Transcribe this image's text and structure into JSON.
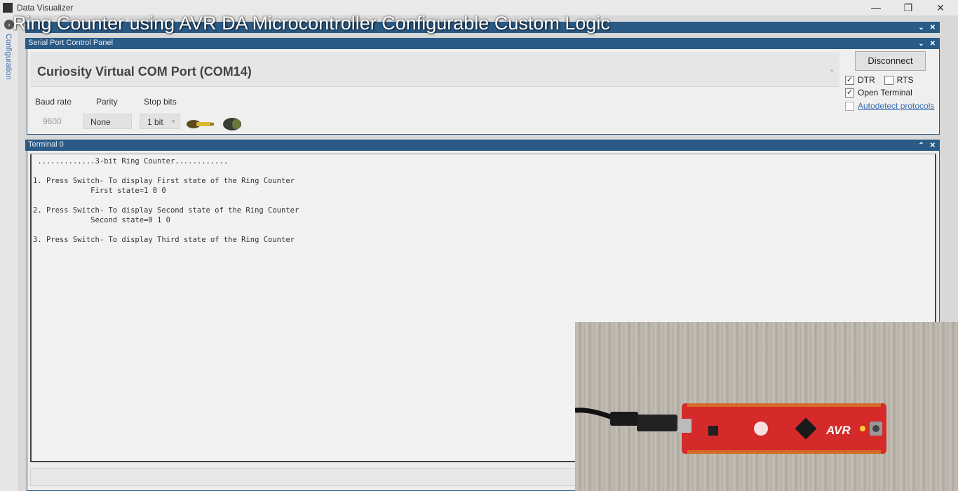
{
  "window": {
    "title": "Data Visualizer",
    "minimize": "—",
    "maximize": "❐",
    "close": "✕"
  },
  "video_title": "Ring Counter using AVR DA Microcontroller Configurable Custom Logic",
  "sidebar": {
    "label": "Configuration"
  },
  "serial_panel": {
    "title": "Serial Port Control Panel",
    "port_name": "Curiosity Virtual COM Port (COM14)",
    "labels": {
      "baud": "Baud rate",
      "parity": "Parity",
      "stop": "Stop bits"
    },
    "values": {
      "baud": "9600",
      "parity": "None",
      "stop": "1 bit"
    },
    "disconnect_label": "Disconnect",
    "checkboxes": {
      "dtr": {
        "label": "DTR",
        "checked": true
      },
      "rts": {
        "label": "RTS",
        "checked": false
      },
      "open_terminal": {
        "label": "Open Terminal",
        "checked": true
      },
      "autodetect": {
        "label": "Autodetect protocols",
        "checked": false
      }
    }
  },
  "terminal": {
    "title": "Terminal 0",
    "lines": [
      " .............3-bit Ring Counter............",
      "",
      "1. Press Switch- To display First state of the Ring Counter",
      "             First state=1 0 0",
      "",
      "2. Press Switch- To display Second state of the Ring Counter",
      "             Second state=0 1 0",
      "",
      "3. Press Switch- To display Third state of the Ring Counter"
    ]
  },
  "board": {
    "brand_text": "AVR"
  },
  "colors": {
    "panel_bar": "#2a5a86",
    "board": "#d42a2a",
    "link": "#3a6fb3"
  }
}
